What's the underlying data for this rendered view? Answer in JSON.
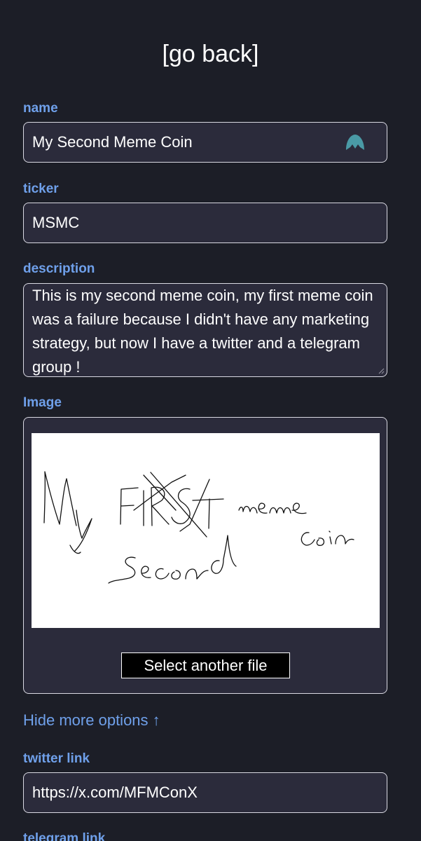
{
  "header": {
    "back_label": "[go back]"
  },
  "form": {
    "name_label": "name",
    "name_value": "My Second Meme Coin",
    "ticker_label": "ticker",
    "ticker_value": "MSMC",
    "description_label": "description",
    "description_value": "This is my second meme coin, my first meme coin was a failure because I didn't have any marketing strategy, but now I have a twitter and a telegram group !",
    "image_label": "Image",
    "image_drawing_text": "My FIRST Second meme coin",
    "select_file_label": "Select another file",
    "toggle_options_label": "Hide more options ↑",
    "twitter_label": "twitter link",
    "twitter_value": "https://x.com/MFMConX",
    "telegram_label": "telegram link"
  },
  "icons": {
    "name_field_extension": "extension-logo-icon"
  },
  "colors": {
    "background": "#1c1e27",
    "field_background": "#2b2b3b",
    "label_accent": "#6fa0ea",
    "icon_teal": "#4a9aa6"
  }
}
